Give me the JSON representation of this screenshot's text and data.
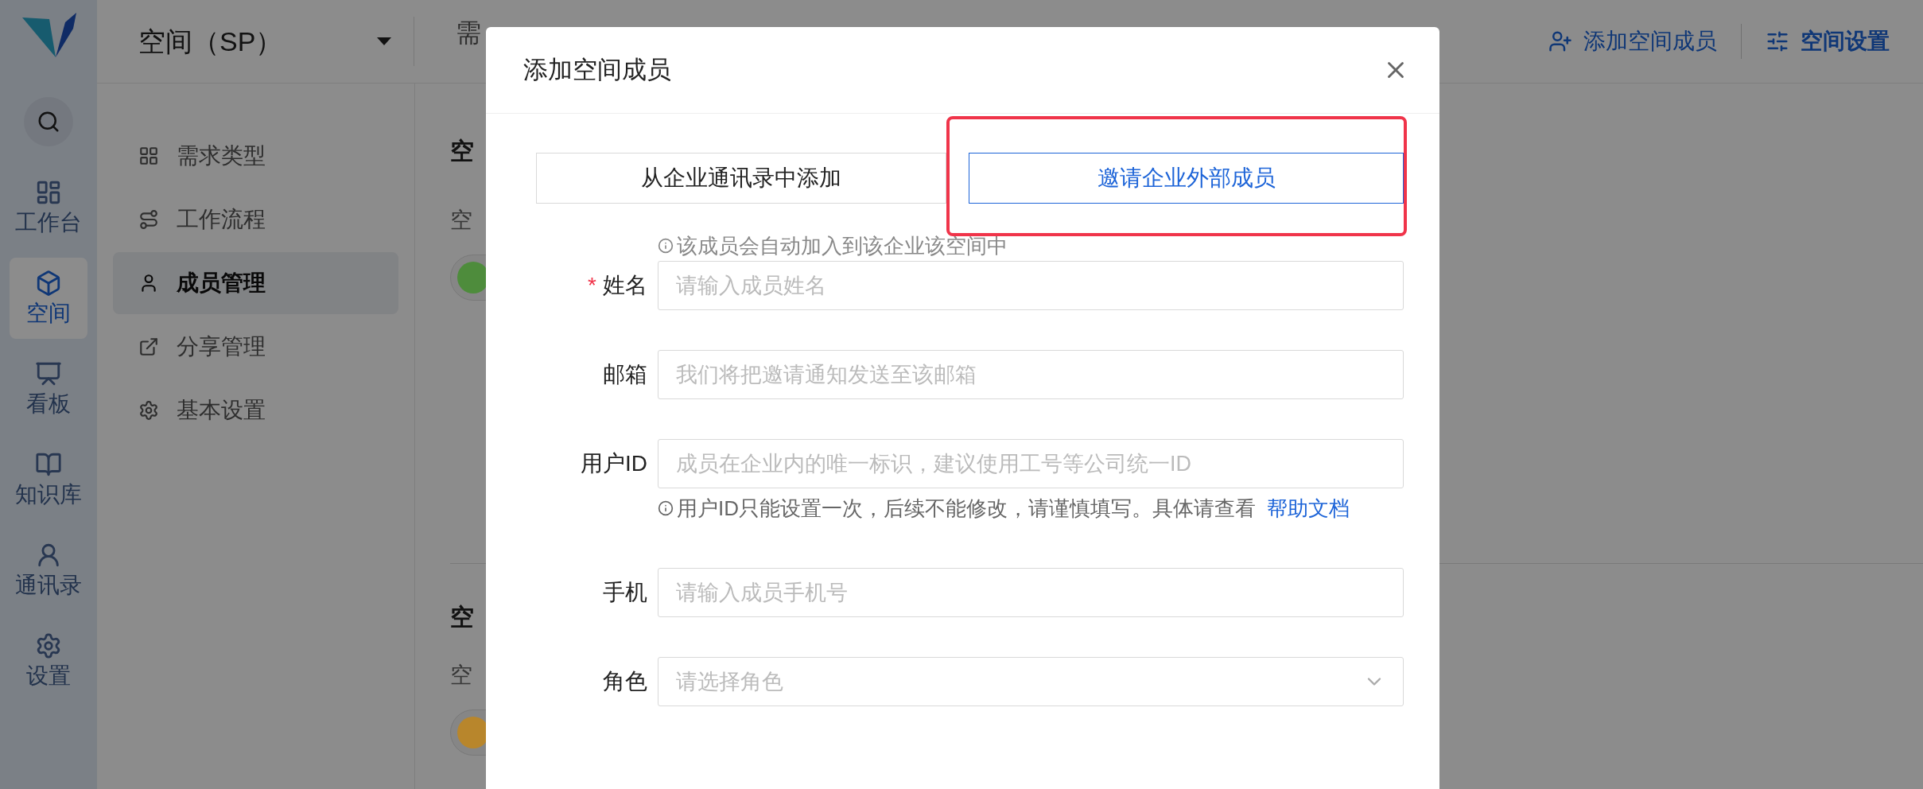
{
  "sidebar": {
    "items": [
      {
        "label": "工作台",
        "selected": false
      },
      {
        "label": "空间",
        "selected": true
      },
      {
        "label": "看板",
        "selected": false
      },
      {
        "label": "知识库",
        "selected": false
      },
      {
        "label": "通讯录",
        "selected": false
      },
      {
        "label": "设置",
        "selected": false
      }
    ]
  },
  "header": {
    "space_selector": "空间（SP）",
    "tabs": [
      {
        "label": "需"
      }
    ],
    "actions": [
      {
        "label": "添加空间成员",
        "bold": false
      },
      {
        "label": "空间设置",
        "bold": true
      }
    ]
  },
  "settings_nav": {
    "items": [
      {
        "label": "需求类型",
        "selected": false
      },
      {
        "label": "工作流程",
        "selected": false
      },
      {
        "label": "成员管理",
        "selected": true
      },
      {
        "label": "分享管理",
        "selected": false
      },
      {
        "label": "基本设置",
        "selected": false
      }
    ]
  },
  "content": {
    "sections": [
      {
        "heading": "空",
        "text": "空",
        "color": "#4e8c3c"
      },
      {
        "heading": "空",
        "text": "空",
        "color": "#b8862c"
      }
    ]
  },
  "dialog": {
    "title": "添加空间成员",
    "tabs": [
      {
        "label": "从企业通讯录中添加",
        "selected": false
      },
      {
        "label": "邀请企业外部成员",
        "selected": true
      }
    ],
    "notice": "该成员会自动加入到该企业该空间中",
    "required_mark": "*",
    "fields": [
      {
        "kind": "text",
        "label": "姓名",
        "required": true,
        "placeholder": "请输入成员姓名"
      },
      {
        "kind": "text",
        "label": "邮箱",
        "required": false,
        "placeholder": "我们将把邀请通知发送至该邮箱"
      },
      {
        "kind": "text",
        "label": "用户ID",
        "required": false,
        "placeholder": "成员在企业内的唯一标识，建议使用工号等公司统一ID",
        "hint": "用户ID只能设置一次，后续不能修改，请谨慎填写。具体请查看",
        "hint_link": "帮助文档"
      },
      {
        "kind": "text",
        "label": "手机",
        "required": false,
        "placeholder": "请输入成员手机号"
      },
      {
        "kind": "select",
        "label": "角色",
        "required": false,
        "placeholder": "请选择角色"
      }
    ]
  }
}
